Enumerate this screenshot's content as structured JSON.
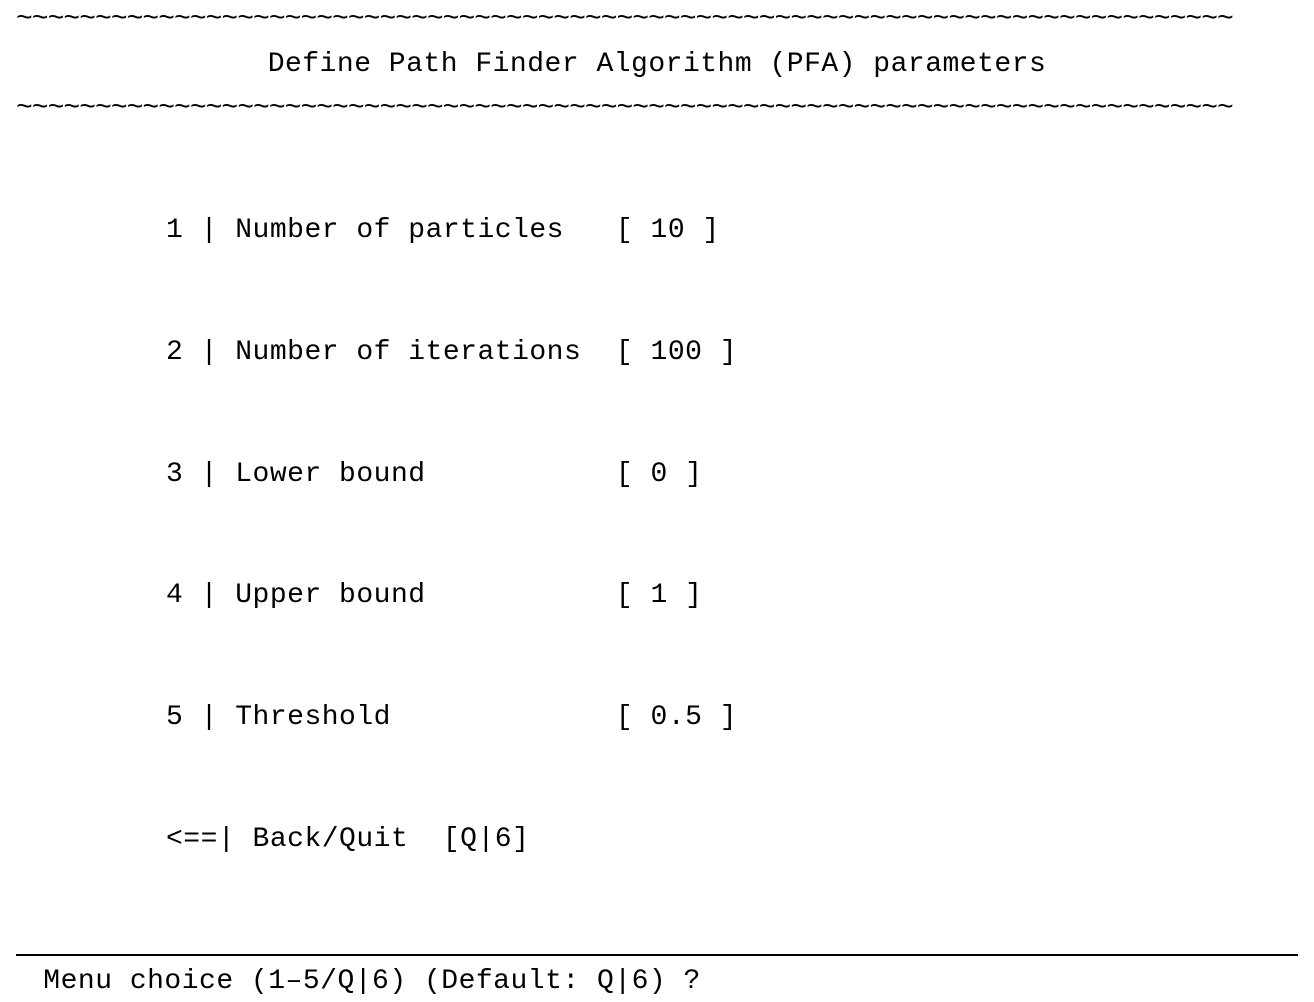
{
  "wave": "~~~~~~~~~~~~~~~~~~~~~~~~~~~~~~~~~~~~~~~~~~~~~~~~~~~~~~~~~~~~~~~~~~~~~~~~~~~~~",
  "title": "Define Path Finder Algorithm (PFA) parameters",
  "menu": {
    "items": [
      {
        "idx": "1",
        "label": "Number of particles",
        "value": "10"
      },
      {
        "idx": "2",
        "label": "Number of iterations",
        "value": "100"
      },
      {
        "idx": "3",
        "label": "Lower bound",
        "value": "0"
      },
      {
        "idx": "4",
        "label": "Upper bound",
        "value": "1"
      },
      {
        "idx": "5",
        "label": "Threshold",
        "value": "0.5"
      }
    ],
    "back": {
      "marker": "<==",
      "label": "Back/Quit  [Q|6]"
    }
  },
  "prompt": " Menu choice (1–5/Q|6) (Default: Q|6) ?"
}
